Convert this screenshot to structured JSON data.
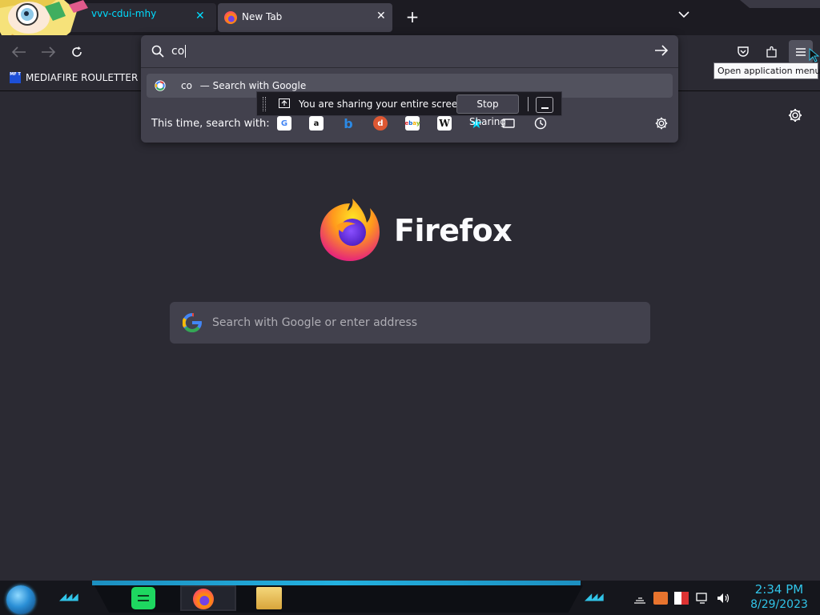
{
  "tabs": [
    {
      "title": "vvv-cdui-mhy",
      "close": "✕"
    },
    {
      "title": "New Tab",
      "close": "✕"
    }
  ],
  "new_tab": "+",
  "tab_list": "⌄",
  "bookmarks": [
    {
      "label": "MEDIAFIRE ROULETTER",
      "icon_text": "MF T"
    }
  ],
  "urlbar": {
    "value": "co",
    "result_query": "co",
    "result_suffix": "— Search with Google",
    "oneoff_label": "This time, search with:",
    "engines": [
      "google",
      "amazon",
      "bing",
      "duckduckgo",
      "ebay",
      "wikipedia",
      "bookmarks",
      "tabs",
      "history"
    ]
  },
  "sharing": {
    "message": "You are sharing your entire screen.",
    "stop_label": "Stop Sharing"
  },
  "tooltip": "Open application menu",
  "newtab": {
    "brand": "Firefox",
    "search_placeholder": "Search with Google or enter address"
  },
  "taskbar": {
    "time": "2:34 PM",
    "date": "8/29/2023",
    "apps": [
      "spotify",
      "firefox",
      "file-explorer"
    ]
  },
  "colors": {
    "accent": "#00ddff",
    "taskbar_accent": "#31c4e8",
    "bg": "#2b2a33"
  }
}
